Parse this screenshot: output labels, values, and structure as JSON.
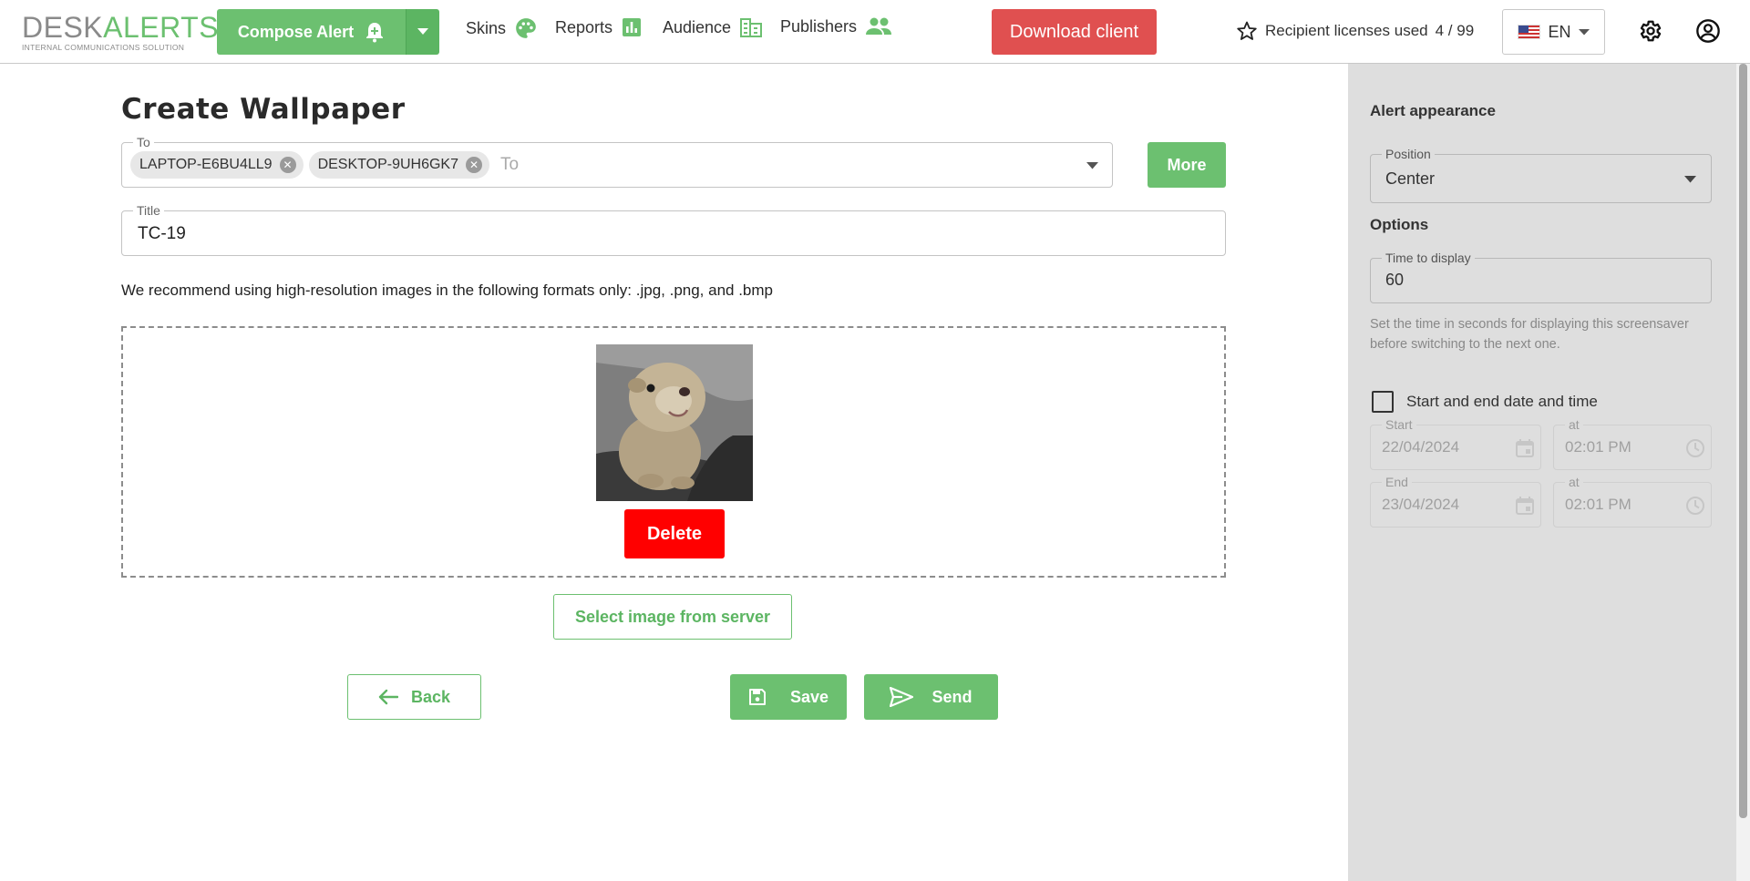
{
  "header": {
    "logo": {
      "part1": "DESK",
      "part2": "ALERTS",
      "tagline": "INTERNAL COMMUNICATIONS SOLUTION"
    },
    "compose_label": "Compose Alert",
    "nav": [
      {
        "label": "Skins",
        "icon": "palette-icon"
      },
      {
        "label": "Reports",
        "icon": "bar-chart-icon"
      },
      {
        "label": "Audience",
        "icon": "audience-icon"
      },
      {
        "label": "Publishers",
        "icon": "people-icon"
      }
    ],
    "download_label": "Download client",
    "licenses_label": "Recipient licenses used",
    "licenses_value": "4 / 99",
    "language": "EN",
    "accent_color": "#6cc070",
    "download_color": "#e05050"
  },
  "form": {
    "title": "Create Wallpaper",
    "to": {
      "legend": "To",
      "placeholder": "To",
      "chips": [
        "LAPTOP-E6BU4LL9",
        "DESKTOP-9UH6GK7"
      ]
    },
    "more_label": "More",
    "title_field": {
      "legend": "Title",
      "value": "TC-19"
    },
    "recommendation": "We recommend using high-resolution images in the following formats only: .jpg, .png, and .bmp",
    "delete_label": "Delete",
    "select_server_label": "Select image from server",
    "back_label": "Back",
    "save_label": "Save",
    "send_label": "Send",
    "delete_color": "#ff0000"
  },
  "sidebar": {
    "appearance_heading": "Alert appearance",
    "position": {
      "legend": "Position",
      "value": "Center"
    },
    "options_heading": "Options",
    "time_to_display": {
      "legend": "Time to display",
      "value": "60"
    },
    "time_hint": "Set the time in seconds for displaying this screensaver before switching to the next one.",
    "schedule_checkbox_label": "Start and end date and time",
    "schedule_checked": false,
    "start": {
      "legend": "Start",
      "value": "22/04/2024"
    },
    "start_time": {
      "legend": "at",
      "value": "02:01 PM"
    },
    "end": {
      "legend": "End",
      "value": "23/04/2024"
    },
    "end_time": {
      "legend": "at",
      "value": "02:01 PM"
    }
  }
}
